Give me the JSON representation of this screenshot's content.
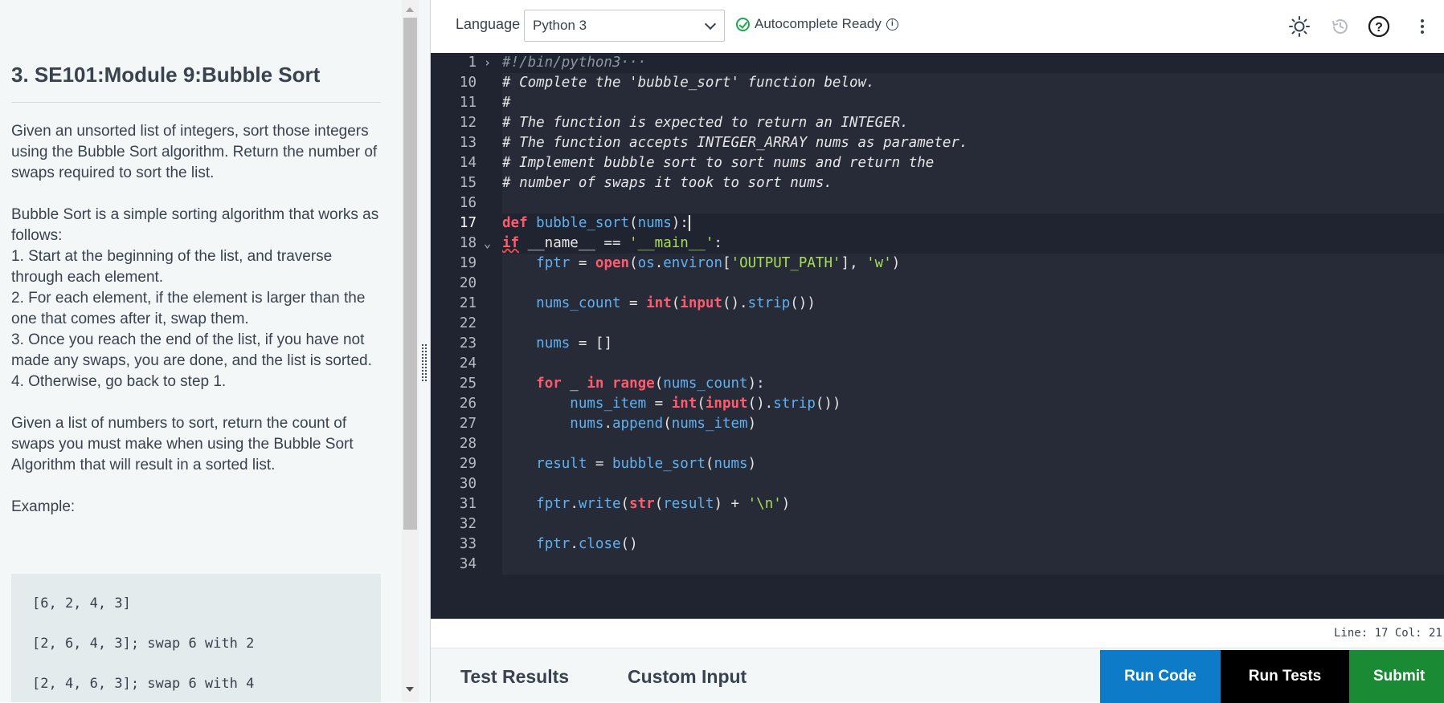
{
  "problem": {
    "title": "3. SE101:Module 9:Bubble Sort",
    "paragraph1": "Given an unsorted list of integers, sort those integers using the Bubble Sort algorithm. Return the number of swaps required to sort the list.",
    "paragraph2_intro": "Bubble Sort is a simple sorting algorithm that works as follows:",
    "steps": [
      "1. Start at the beginning of the list, and traverse through each element.",
      "2. For each element, if the element is larger than the one that comes after it, swap them.",
      "3. Once you reach the end of the list, if you have not made any swaps, you are done, and the list is sorted.",
      "4. Otherwise, go back to step 1."
    ],
    "paragraph3": "Given a list of numbers to sort, return the count of swaps you must make when using the Bubble Sort Algorithm that will result in a sorted list.",
    "example_label": "Example:",
    "example_lines": [
      "[6, 2, 4, 3]",
      "[2, 6, 4, 3]; swap 6 with 2",
      "[2, 4, 6, 3]; swap 6 with 4"
    ]
  },
  "toolbar": {
    "language_label": "Language",
    "language_selected": "Python 3",
    "autocomplete_status": "Autocomplete Ready",
    "icons": [
      "sun-icon",
      "history-icon",
      "help-icon",
      "more-vertical-icon"
    ]
  },
  "editor": {
    "line_numbers": [
      "1",
      "10",
      "11",
      "12",
      "13",
      "14",
      "15",
      "16",
      "17",
      "18",
      "19",
      "20",
      "21",
      "22",
      "23",
      "24",
      "25",
      "26",
      "27",
      "28",
      "29",
      "30",
      "31",
      "32",
      "33",
      "34"
    ],
    "collapsed_header": "#!/bin/python3",
    "current_line": "17"
  },
  "status": {
    "position": "Line: 17 Col: 21"
  },
  "bottom": {
    "tab_test_results": "Test Results",
    "tab_custom_input": "Custom Input",
    "run_code": "Run Code",
    "run_tests": "Run Tests",
    "submit": "Submit"
  },
  "colors": {
    "editor_bg": "#1f2430",
    "run_code_bg": "#0e7bc8",
    "run_tests_bg": "#000000",
    "submit_bg": "#1a8a35",
    "keyword": "#ff5a6e",
    "function": "#5fb1f2",
    "string": "#a6de55",
    "comment": "#8d96a3"
  }
}
